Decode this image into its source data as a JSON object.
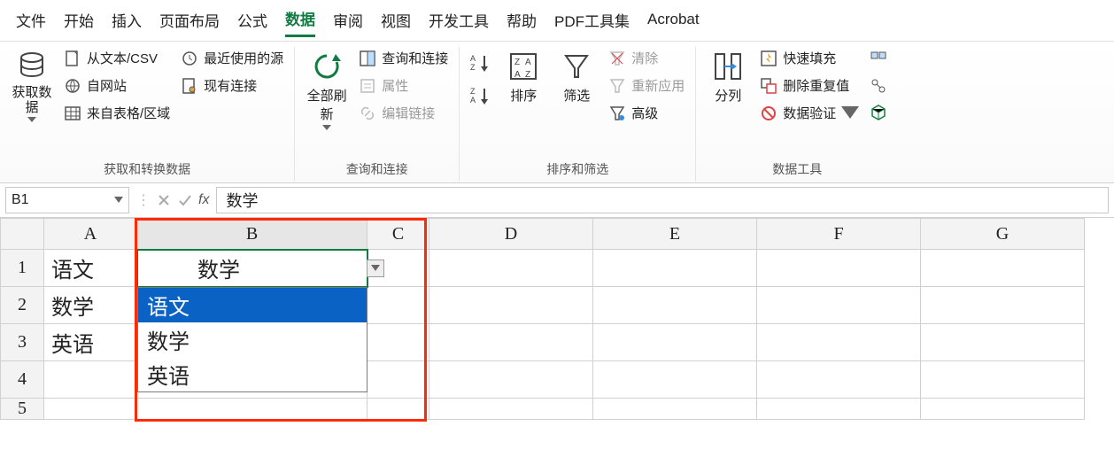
{
  "menu": {
    "tabs": [
      "文件",
      "开始",
      "插入",
      "页面布局",
      "公式",
      "数据",
      "审阅",
      "视图",
      "开发工具",
      "帮助",
      "PDF工具集",
      "Acrobat"
    ],
    "active_index": 5
  },
  "ribbon": {
    "groups": [
      {
        "label": "获取和转换数据",
        "big": {
          "label": "获取数\n据"
        },
        "items": [
          "从文本/CSV",
          "自网站",
          "来自表格/区域",
          "最近使用的源",
          "现有连接"
        ]
      },
      {
        "label": "查询和连接",
        "big": {
          "label": "全部刷新"
        },
        "items": [
          "查询和连接",
          "属性",
          "编辑链接"
        ]
      },
      {
        "label": "排序和筛选",
        "big1_hint": "升降序",
        "big2": {
          "label": "排序"
        },
        "big3": {
          "label": "筛选"
        },
        "items": [
          "清除",
          "重新应用",
          "高级"
        ]
      },
      {
        "label": "数据工具",
        "big": {
          "label": "分列"
        },
        "items": [
          "快速填充",
          "删除重复值",
          "数据验证"
        ]
      }
    ]
  },
  "formula_bar": {
    "name_box": "B1",
    "fx": "fx",
    "value": "数学"
  },
  "columns": [
    "A",
    "B",
    "C",
    "D",
    "E",
    "F",
    "G"
  ],
  "rows": [
    "1",
    "2",
    "3",
    "4",
    "5"
  ],
  "cells": {
    "A1": "语文",
    "A2": "数学",
    "A3": "英语",
    "B1": "数学"
  },
  "validation_list": {
    "options": [
      "语文",
      "数学",
      "英语"
    ],
    "selected_index": 0
  }
}
